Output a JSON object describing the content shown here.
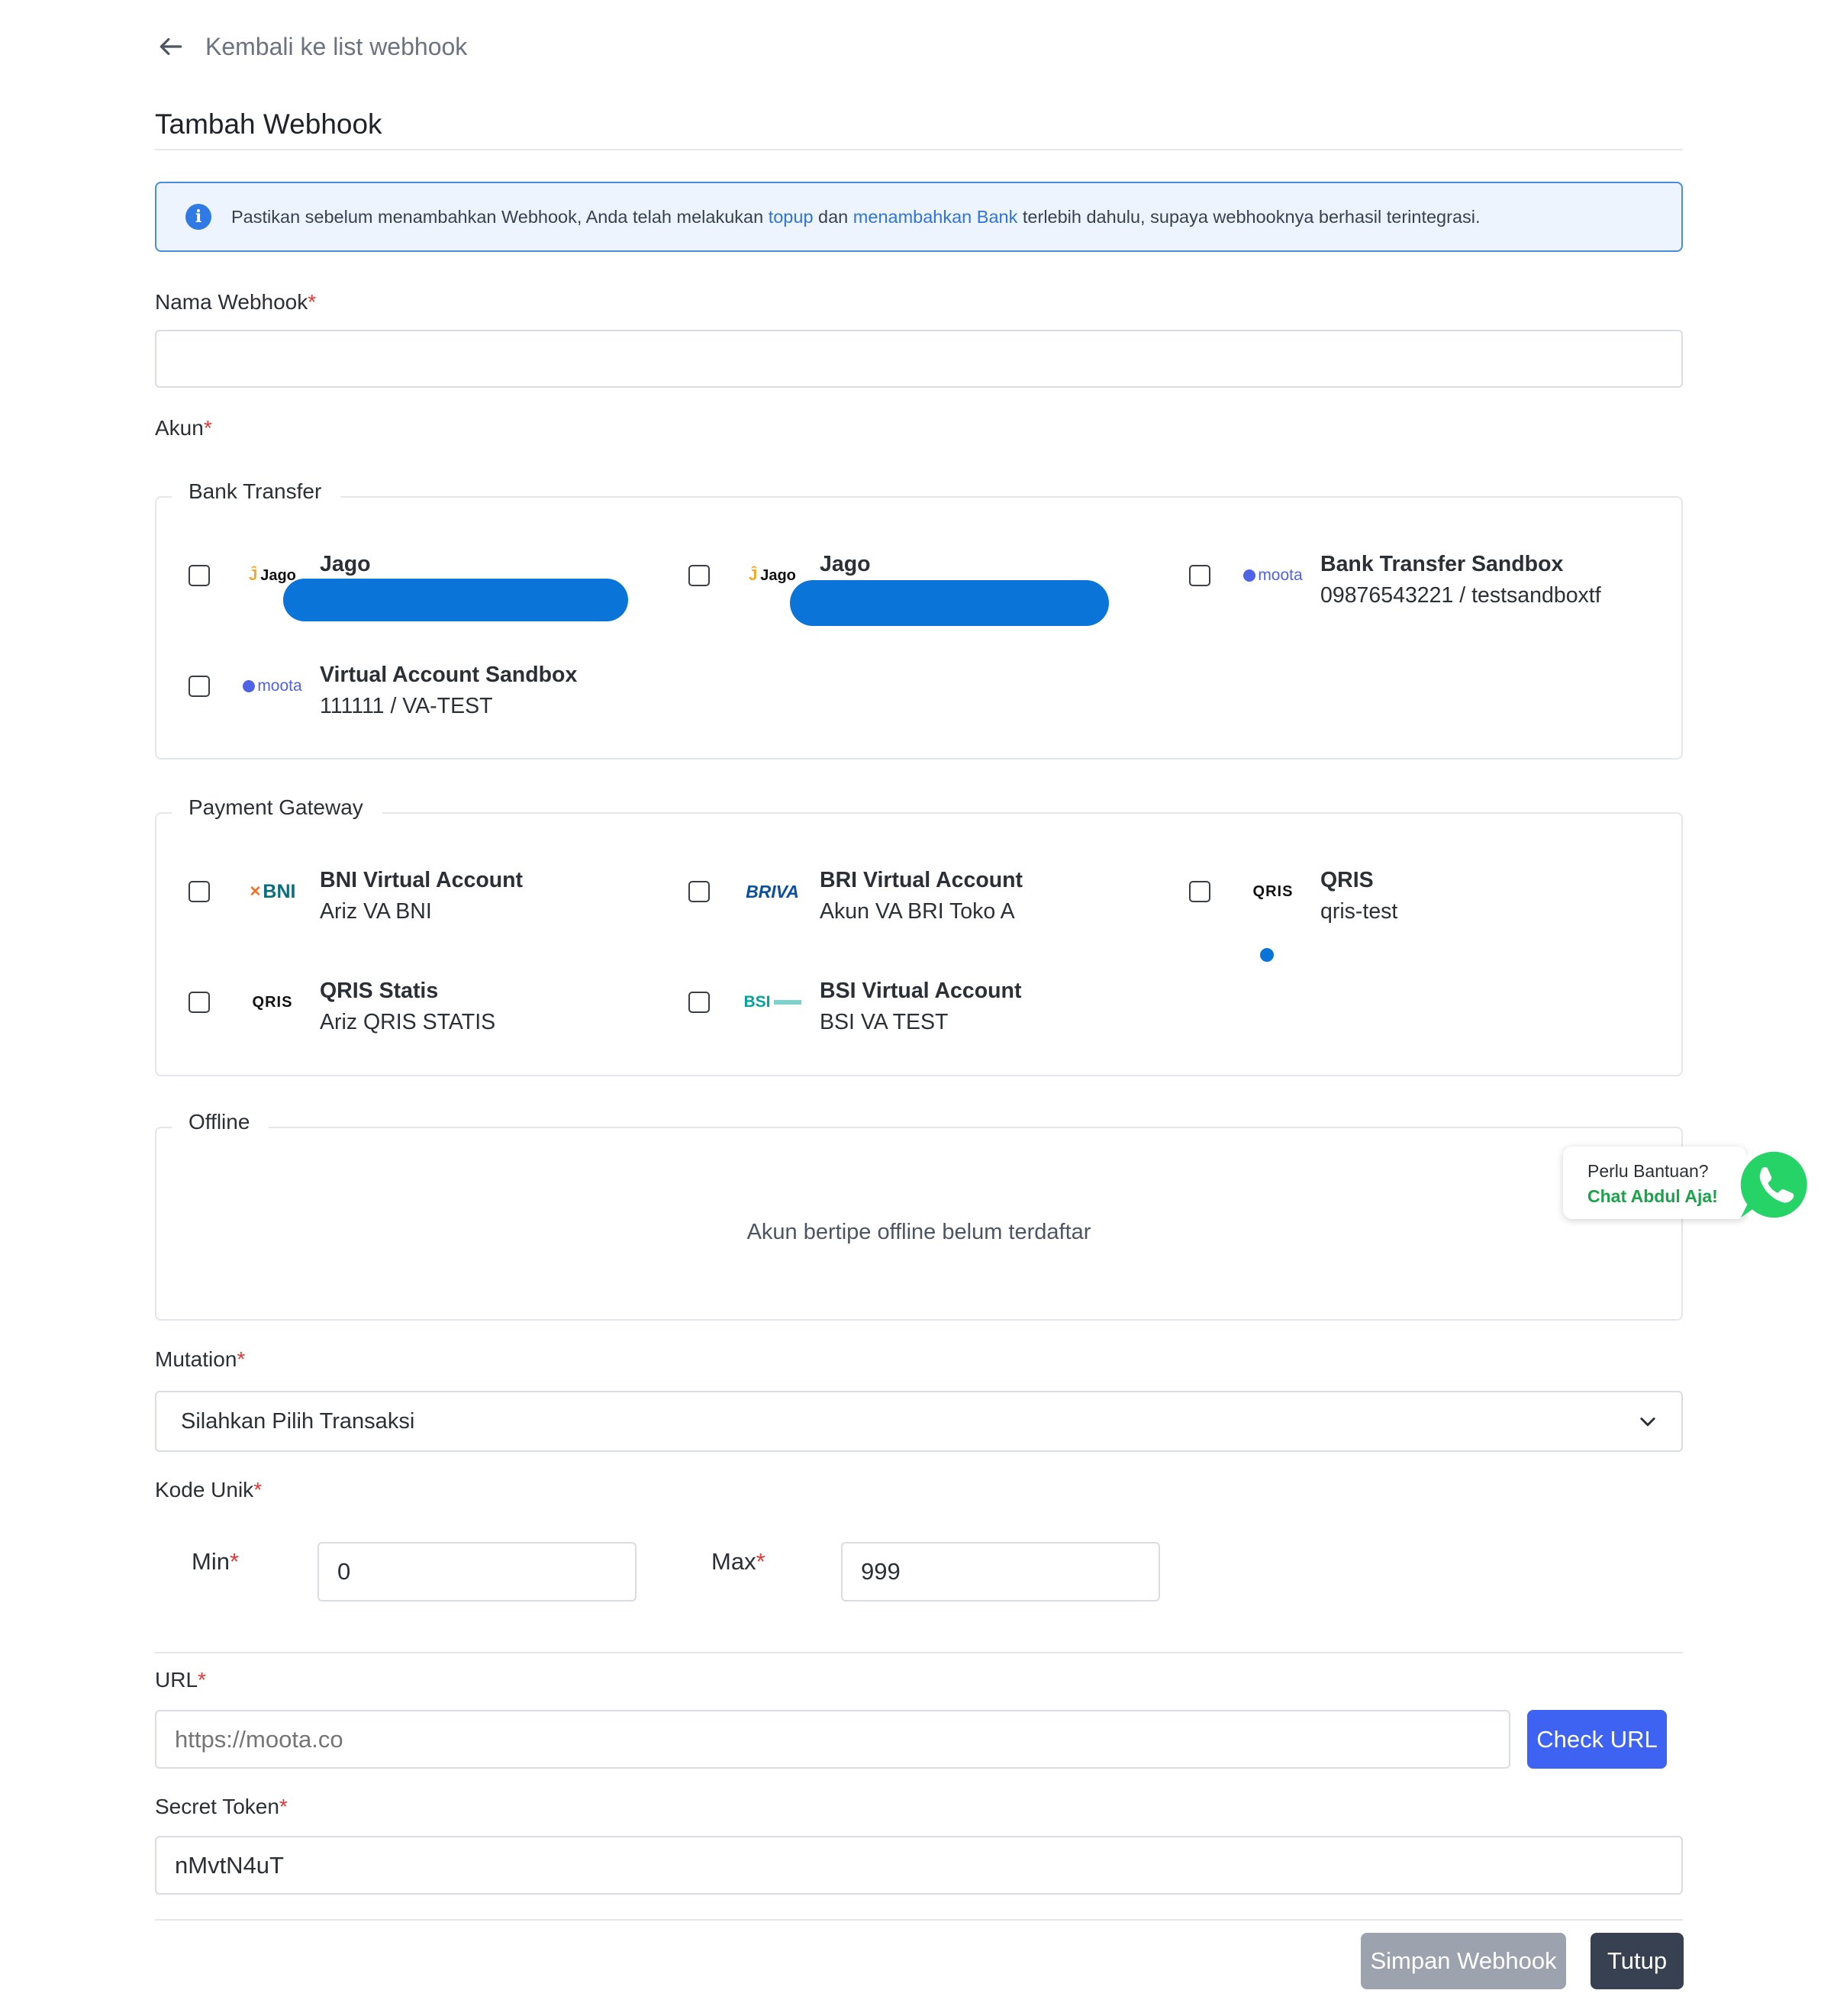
{
  "back_link": {
    "label": "Kembali ke list webhook"
  },
  "page_title": "Tambah Webhook",
  "alert": {
    "text_before": "Pastikan sebelum menambahkan Webhook, Anda telah melakukan ",
    "link_topup": "topup",
    "text_mid": " dan ",
    "link_bank": "menambahkan Bank",
    "text_after": " terlebih dahulu, supaya webhooknya berhasil terintegrasi."
  },
  "fields": {
    "nama_webhook": {
      "label": "Nama Webhook",
      "required_mark": "*",
      "value": ""
    },
    "akun": {
      "label": "Akun",
      "required_mark": "*"
    },
    "mutation": {
      "label": "Mutation",
      "required_mark": "*",
      "selected": "Silahkan Pilih Transaksi"
    },
    "kode_unik": {
      "label": "Kode Unik",
      "required_mark": "*",
      "min_label": "Min",
      "min_value": "0",
      "max_label": "Max",
      "max_value": "999"
    },
    "url": {
      "label": "URL",
      "required_mark": "*",
      "placeholder": "https://moota.co",
      "check_button": "Check URL"
    },
    "secret_token": {
      "label": "Secret Token",
      "required_mark": "*",
      "value": "nMvtN4uT"
    }
  },
  "groups": {
    "bank_transfer": {
      "legend": "Bank Transfer",
      "accounts": [
        {
          "logo": "Jago",
          "name": "Jago",
          "sub": ""
        },
        {
          "logo": "Jago",
          "name": "Jago",
          "sub": ""
        },
        {
          "logo": "moota",
          "name": "Bank Transfer Sandbox",
          "sub": "09876543221 / testsandboxtf"
        },
        {
          "logo": "moota",
          "name": "Virtual Account Sandbox",
          "sub": "111111 / VA-TEST"
        }
      ]
    },
    "payment_gateway": {
      "legend": "Payment Gateway",
      "accounts": [
        {
          "logo": "BNI",
          "name": "BNI Virtual Account",
          "sub": "Ariz VA BNI"
        },
        {
          "logo": "BRIVA",
          "name": "BRI Virtual Account",
          "sub": "Akun VA BRI Toko A"
        },
        {
          "logo": "QRIS",
          "name": "QRIS",
          "sub": "qris-test"
        },
        {
          "logo": "QRIS",
          "name": "QRIS Statis",
          "sub": "Ariz QRIS STATIS"
        },
        {
          "logo": "BSI",
          "name": "BSI Virtual Account",
          "sub": "BSI VA TEST"
        }
      ]
    },
    "offline": {
      "legend": "Offline",
      "empty_message": "Akun bertipe offline belum terdaftar"
    }
  },
  "footer": {
    "save_button": "Simpan Webhook",
    "close_button": "Tutup"
  },
  "help_widget": {
    "line1": "Perlu Bantuan?",
    "line2": "Chat Abdul Aja!"
  },
  "colors": {
    "link": "#2f74db",
    "alert_border": "#4a8ce0",
    "alert_bg": "#eef4fd",
    "required": "#e53935",
    "primary_button": "#3e63f3",
    "save_button_disabled": "#9ca3af",
    "close_button": "#374151",
    "whatsapp": "#25d366"
  }
}
